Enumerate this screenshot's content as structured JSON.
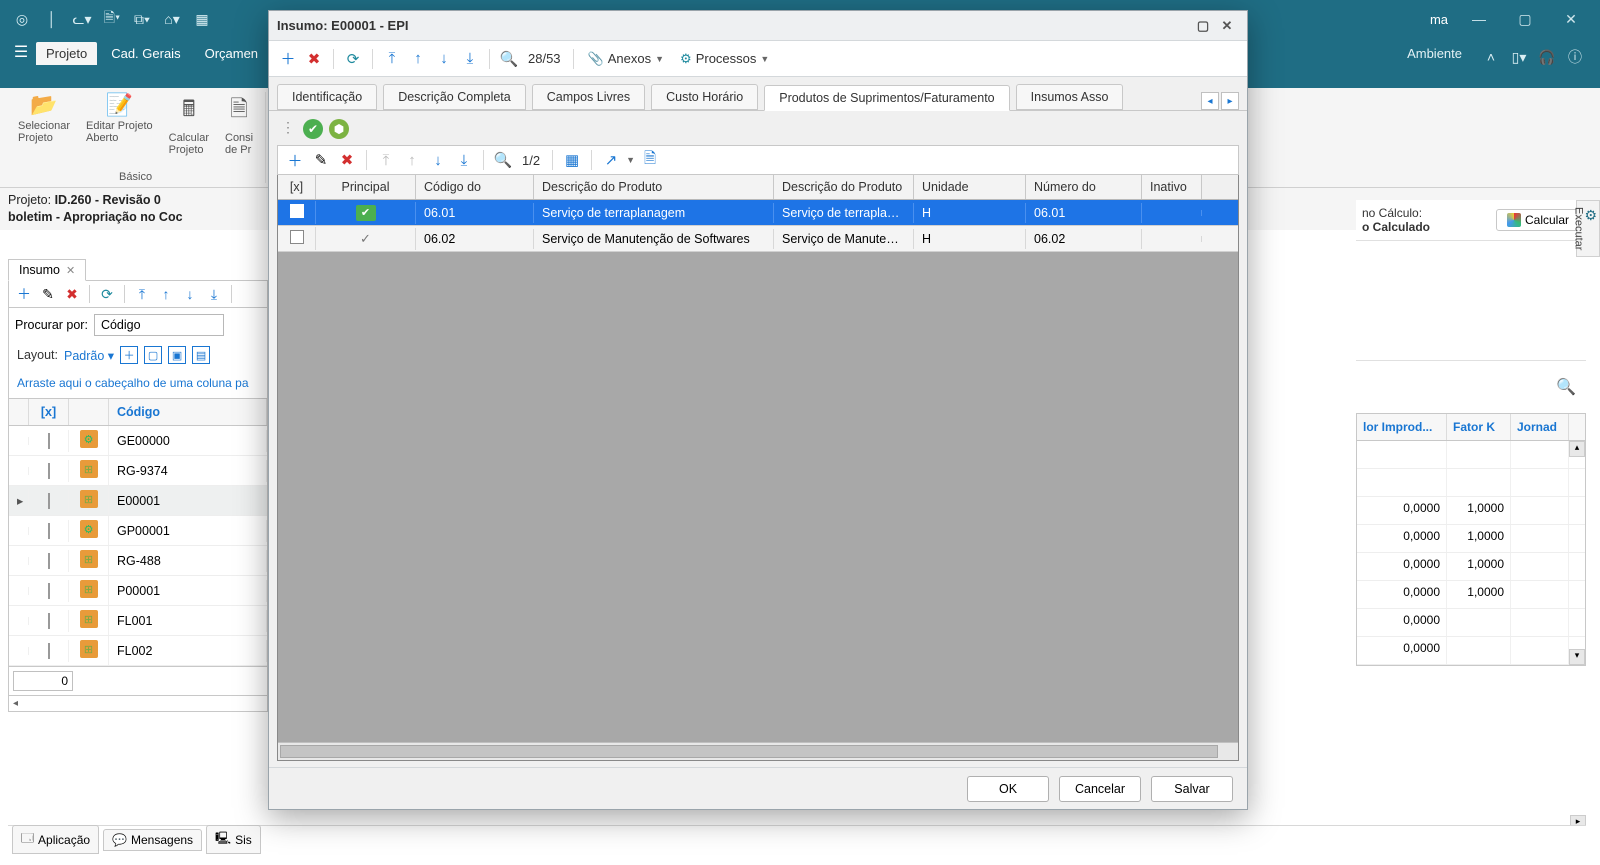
{
  "teal_header": {
    "right_tag": "ma",
    "ambiente": "Ambiente"
  },
  "ribbon_tabs": {
    "file_icon": "☰",
    "projeto": "Projeto",
    "cad_gerais": "Cad. Gerais",
    "orcamen": "Orçamen"
  },
  "ribbon_groups": {
    "selecionar": "Selecionar\nProjeto",
    "editar": "Editar Projeto\nAberto",
    "calcular": "Calcular\nProjeto",
    "consi": "Consi\nde Pr",
    "basico": "Básico"
  },
  "project_line": {
    "label": "Projeto:",
    "id": "ID.260 - Revisão 0",
    "sub": "boletim - Apropriação no Coc"
  },
  "left": {
    "tab": "Insumo",
    "procurar_label": "Procurar por:",
    "procurar_value": "Código",
    "layout_label": "Layout:",
    "layout_value": "Padrão",
    "drag_hint": "Arraste aqui o cabeçalho de uma coluna pa",
    "head_chk": "[x]",
    "head_cod": "Código",
    "rows": [
      {
        "code": "GE00000",
        "type": "blue"
      },
      {
        "code": "RG-9374",
        "type": "orange"
      },
      {
        "code": "E00001",
        "type": "orange",
        "selected": true
      },
      {
        "code": "GP00001",
        "type": "blue"
      },
      {
        "code": "RG-488",
        "type": "orange"
      },
      {
        "code": "P00001",
        "type": "orange"
      },
      {
        "code": "FL001",
        "type": "orange"
      },
      {
        "code": "FL002",
        "type": "orange"
      }
    ],
    "count": "0"
  },
  "right": {
    "calc_hint1": "no Cálculo:",
    "calc_hint2": "o Calculado",
    "calcular_btn": "Calcular",
    "executar": "Executar",
    "head1": "lor Improd...",
    "head2": "Fator K",
    "head3": "Jornad",
    "rows": [
      {
        "v1": "",
        "v2": "",
        "v3": ""
      },
      {
        "v1": "",
        "v2": "",
        "v3": ""
      },
      {
        "v1": "0,0000",
        "v2": "1,0000",
        "v3": ""
      },
      {
        "v1": "0,0000",
        "v2": "1,0000",
        "v3": ""
      },
      {
        "v1": "0,0000",
        "v2": "1,0000",
        "v3": ""
      },
      {
        "v1": "0,0000",
        "v2": "1,0000",
        "v3": ""
      },
      {
        "v1": "0,0000",
        "v2": "",
        "v3": ""
      },
      {
        "v1": "0,0000",
        "v2": "",
        "v3": ""
      }
    ]
  },
  "status": {
    "aplicacao": "Aplicação",
    "mensagens": "Mensagens",
    "sis": "Sis"
  },
  "modal": {
    "title": "Insumo: E00001 - EPI",
    "counter": "28/53",
    "anexos": "Anexos",
    "processos": "Processos",
    "tabs": {
      "identificacao": "Identificação",
      "descricao": "Descrição Completa",
      "campos": "Campos Livres",
      "custo": "Custo Horário",
      "produtos": "Produtos de Suprimentos/Faturamento",
      "insumos": "Insumos Asso"
    },
    "grid_counter": "1/2",
    "grid_head": {
      "chk": "[x]",
      "principal": "Principal",
      "codigo": "Código do",
      "desc1": "Descrição do Produto",
      "desc2": "Descrição do Produto",
      "unidade": "Unidade",
      "numero": "Número do",
      "inativo": "Inativo"
    },
    "grid_rows": [
      {
        "selected": true,
        "principal": true,
        "codigo": "06.01",
        "desc1": "Serviço de terraplanagem",
        "desc2": "Serviço de terraplanag...",
        "unidade": "H",
        "numero": "06.01"
      },
      {
        "selected": false,
        "principal": false,
        "codigo": "06.02",
        "desc1": "Serviço de Manutenção de Softwares",
        "desc2": "Serviço de Manutenç...",
        "unidade": "H",
        "numero": "06.02"
      }
    ],
    "buttons": {
      "ok": "OK",
      "cancel": "Cancelar",
      "save": "Salvar"
    }
  }
}
